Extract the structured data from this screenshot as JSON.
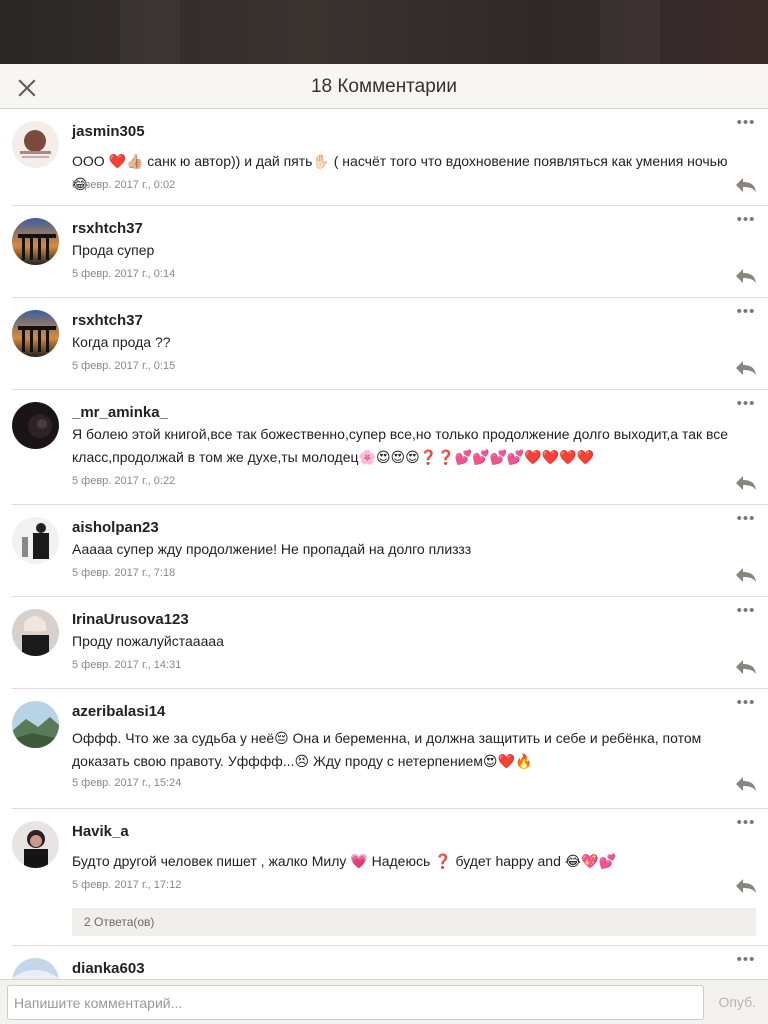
{
  "header": {
    "title": "18 Комментарии"
  },
  "comments": [
    {
      "user": "jasmin305",
      "text": "ООО ❤️👍🏼 санк ю автор)) и дай пять✋🏻 ( насчёт того что вдохновение появляться как умения ночью 😂",
      "date": "5 февр. 2017 г., 0:02"
    },
    {
      "user": "rsxhtch37",
      "text": "Прода супер",
      "date": "5 февр. 2017 г., 0:14"
    },
    {
      "user": "rsxhtch37",
      "text": "Когда прода ??",
      "date": "5 февр. 2017 г., 0:15"
    },
    {
      "user": "_mr_aminka_",
      "text": "Я болею этой книгой,все так божественно,супер все,но только продолжение долго выходит,а так все класс,продолжай в том же духе,ты молодец🌸😍😍😍❓❓💕💕💕💕❤️❤️❤️❤️",
      "date": "5 февр. 2017 г., 0:22"
    },
    {
      "user": "aisholpan23",
      "text": "Ааааа супер жду продолжение! Не пропадай на долго плиззз",
      "date": "5 февр. 2017 г., 7:18"
    },
    {
      "user": "IrinaUrusova123",
      "text": "Проду пожалуйстааааа",
      "date": "5 февр. 2017 г., 14:31"
    },
    {
      "user": "azeribalasi14",
      "text": "Оффф. Что же за судьба у неё😔 Она и беременна, и должна защитить и себе и ребёнка, потом доказать свою правоту. Уфффф...😣 Жду проду с нетерпением😍❤️🔥",
      "date": "5 февр. 2017 г., 15:24"
    },
    {
      "user": "Havik_a",
      "text": "Будто другой человек пишет , жалко Милу 💗 Надеюсь ❓ будет happy and 😂💖💕",
      "date": "5 февр. 2017 г., 17:12",
      "replies": "2 Ответа(ов)"
    },
    {
      "user": "dianka603",
      "text": "",
      "date": ""
    }
  ],
  "footer": {
    "placeholder": "Напишите комментарий...",
    "submit_label": "Опуб."
  },
  "colors": {
    "header_bg": "#f8f6f3",
    "footer_bg": "#f4f2ef",
    "divider": "#e2dfdb",
    "reply_icon": "#8a847e"
  }
}
